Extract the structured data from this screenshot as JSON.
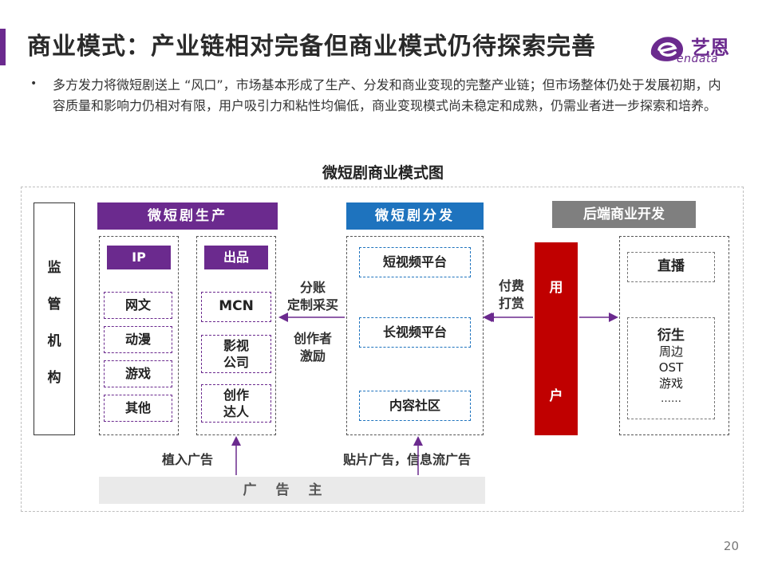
{
  "header": {
    "title": "商业模式：产业链相对完备但商业模式仍待探索完善",
    "logo_cn": "艺恩",
    "logo_en": "endata",
    "brand_color": "#6b2a8e"
  },
  "summary": {
    "bullet": "•",
    "text": "多方发力将微短剧送上 “风口”，市场基本形成了生产、分发和商业变现的完整产业链；但市场整体仍处于发展初期，内容质量和影响力仍相对有限，用户吸引力和粘性均偏低，商业变现模式尚未稳定和成熟，仍需业者进一步探索和培养。"
  },
  "diagram": {
    "title": "微短剧商业模式图",
    "regulator": [
      "监",
      "管",
      "机",
      "构"
    ],
    "production": {
      "header": "微短剧生产",
      "ip": {
        "label": "IP",
        "items": [
          "网文",
          "动漫",
          "游戏",
          "其他"
        ]
      },
      "output": {
        "label": "出品",
        "items": [
          "MCN",
          "影视\n公司",
          "创作\n达人"
        ]
      }
    },
    "distribution": {
      "header": "微短剧分发",
      "items": [
        "短视频平台",
        "长视频平台",
        "内容社区"
      ]
    },
    "backend": {
      "header": "后端商业开发",
      "live": "直播",
      "derivative_title": "衍生",
      "derivative_items": [
        "周边",
        "OST",
        "游戏",
        "……"
      ]
    },
    "user": [
      "用",
      "户"
    ],
    "flows": {
      "revenue_share": "分账\n定制采买",
      "creator_incentive": "创作者\n激励",
      "pay_reward": "付费\n打赏",
      "product_placement": "植入广告",
      "ad_feeds": "贴片广告，信息流广告"
    },
    "advertiser": "广告主",
    "colors": {
      "production": "#6b2a8e",
      "distribution": "#1e73be",
      "backend": "#7f7f7f",
      "user": "#c00000"
    }
  },
  "footer": {
    "page_number": "20"
  }
}
